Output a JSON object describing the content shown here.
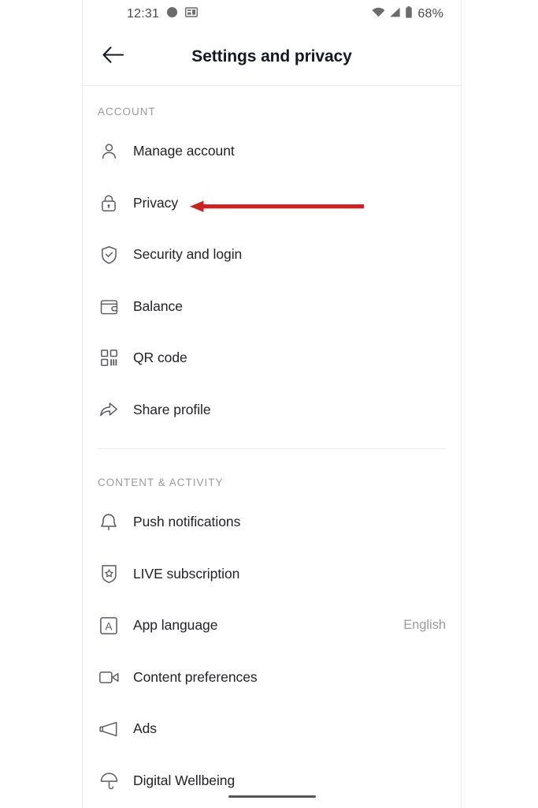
{
  "status_bar": {
    "time": "12:31",
    "battery_percent": "68%",
    "left_icons": [
      "do-not-disturb-icon",
      "screenshot-icon"
    ],
    "right_icons": [
      "wifi-icon",
      "cellular-signal-icon",
      "battery-icon"
    ]
  },
  "app_bar": {
    "back_icon": "back-arrow-icon",
    "title": "Settings and privacy"
  },
  "sections": [
    {
      "header": "ACCOUNT",
      "items": [
        {
          "icon": "person-icon",
          "label": "Manage account",
          "value": ""
        },
        {
          "icon": "lock-icon",
          "label": "Privacy",
          "value": ""
        },
        {
          "icon": "shield-check-icon",
          "label": "Security and login",
          "value": ""
        },
        {
          "icon": "wallet-icon",
          "label": "Balance",
          "value": ""
        },
        {
          "icon": "qr-code-icon",
          "label": "QR code",
          "value": ""
        },
        {
          "icon": "share-arrow-icon",
          "label": "Share profile",
          "value": ""
        }
      ]
    },
    {
      "header": "CONTENT & ACTIVITY",
      "items": [
        {
          "icon": "bell-icon",
          "label": "Push notifications",
          "value": ""
        },
        {
          "icon": "live-shield-icon",
          "label": "LIVE subscription",
          "value": ""
        },
        {
          "icon": "letter-a-box-icon",
          "label": "App language",
          "value": "English"
        },
        {
          "icon": "video-camera-icon",
          "label": "Content preferences",
          "value": ""
        },
        {
          "icon": "megaphone-icon",
          "label": "Ads",
          "value": ""
        },
        {
          "icon": "umbrella-icon",
          "label": "Digital Wellbeing",
          "value": ""
        }
      ]
    }
  ],
  "annotation": {
    "type": "arrow",
    "points_to": "Privacy",
    "color": "#CC2222",
    "direction": "left"
  },
  "colors": {
    "text_primary": "#222227",
    "text_secondary": "#9b9b9b",
    "title": "#161823",
    "icon_stroke": "#5a5a60",
    "divider": "#efefef",
    "annotation_red": "#CC2222"
  },
  "gesture_bar": {
    "label": "home-gesture-pill"
  }
}
